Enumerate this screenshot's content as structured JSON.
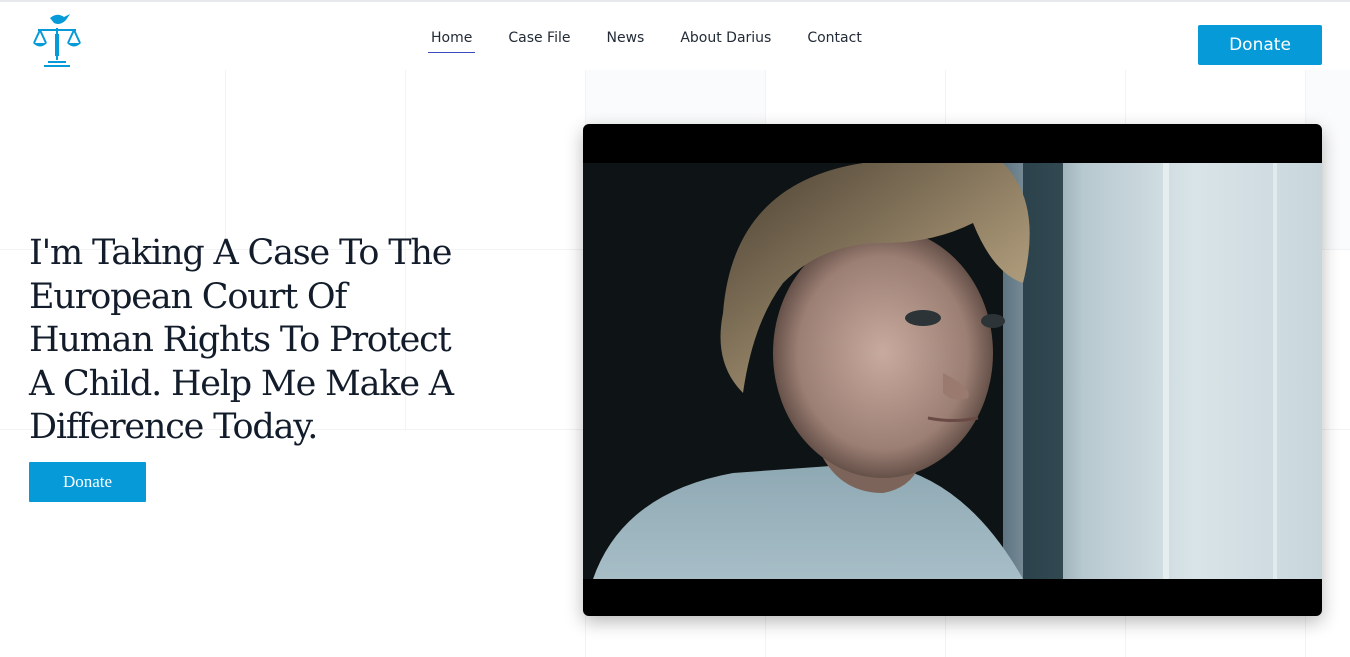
{
  "brand": {
    "logo_icon": "scales-of-justice-dove-icon",
    "accent_color": "#069ad9"
  },
  "nav": {
    "items": [
      {
        "label": "Home",
        "active": true
      },
      {
        "label": "Case File",
        "active": false
      },
      {
        "label": "News",
        "active": false
      },
      {
        "label": "About Darius",
        "active": false
      },
      {
        "label": "Contact",
        "active": false
      }
    ]
  },
  "header": {
    "donate_label": "Donate"
  },
  "hero": {
    "title": "I'm Taking A Case To The European Court Of Human Rights To Protect A Child. Help Me Make A Difference Today.",
    "donate_label": "Donate"
  },
  "video": {
    "subject_icon": "child-at-window-image"
  }
}
